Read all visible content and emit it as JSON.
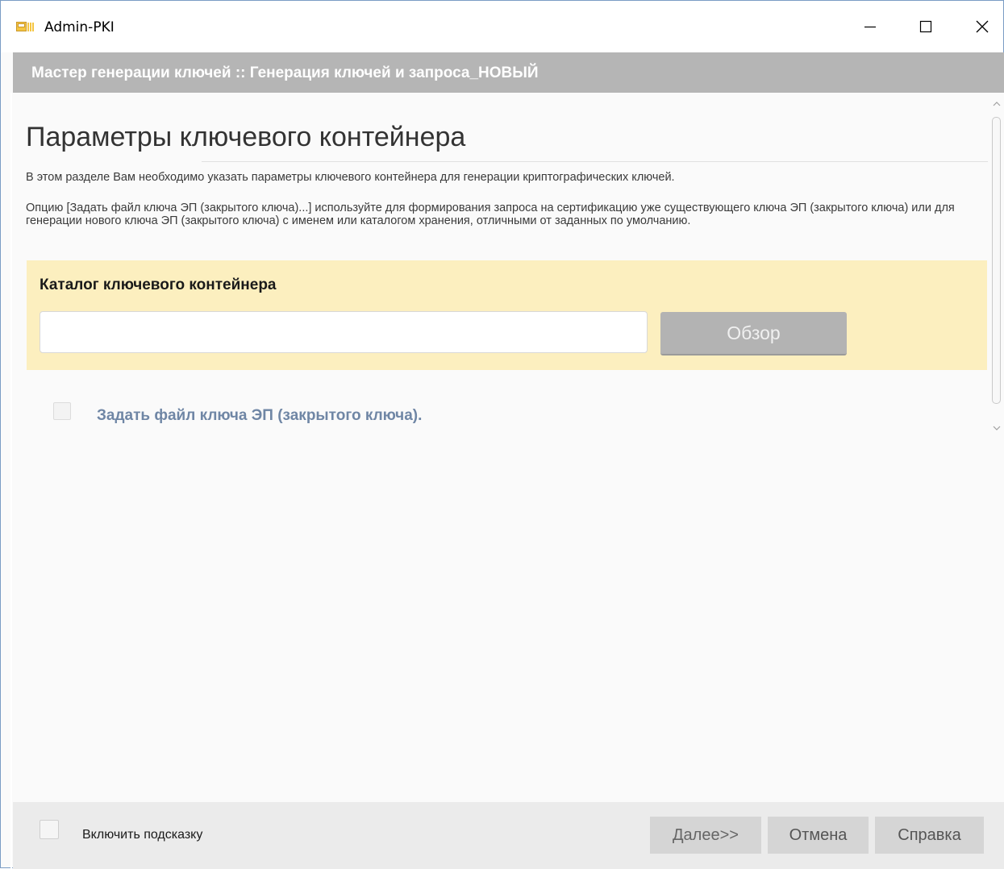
{
  "window": {
    "title": "Admin-PKI"
  },
  "wizard": {
    "header": "Мастер генерации ключей :: Генерация ключей и запроса_НОВЫЙ",
    "page_title": "Параметры ключевого контейнера",
    "description_1": "В этом разделе Вам необходимо указать параметры ключевого контейнера для генерации криптографических ключей.",
    "description_2": "Опцию [Задать файл ключа ЭП (закрытого ключа)...] используйте для формирования запроса на сертификацию уже существующего ключа ЭП (закрытого ключа) или для генерации нового ключа ЭП (закрытого ключа) с именем или каталогом хранения, отличными от заданных по умолчанию.",
    "container_panel": {
      "title": "Каталог ключевого контейнера",
      "path_value": "",
      "browse_label": "Обзор"
    },
    "key_file_option": {
      "label": "Задать файл ключа ЭП (закрытого ключа).",
      "checked": false
    }
  },
  "footer": {
    "hint_label": "Включить подсказку",
    "hint_checked": false,
    "next_label": "Далее>>",
    "cancel_label": "Отмена",
    "help_label": "Справка"
  },
  "colors": {
    "header_band": "#b5b5b5",
    "panel_background": "#fcefbf",
    "key_option_text": "#6f86a5",
    "footer_background": "#ebebeb"
  },
  "icons": {
    "app": "admin-pki-app-icon",
    "minimize": "minimize-icon",
    "maximize": "maximize-icon",
    "close": "close-icon"
  }
}
